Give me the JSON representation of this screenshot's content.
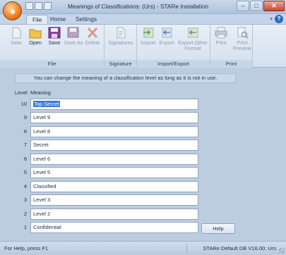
{
  "window": {
    "title": "Meanings of Classifications: (Urs) - STARe Installation",
    "minimize": "–",
    "maximize": "□",
    "close": "✕"
  },
  "tabs": [
    {
      "label": "File",
      "active": true
    },
    {
      "label": "Home",
      "active": false
    },
    {
      "label": "Settings",
      "active": false
    }
  ],
  "help_glyph": "?",
  "ribbon": {
    "groups": [
      {
        "label": "File",
        "buttons": [
          {
            "label": "New",
            "enabled": false,
            "icon": "new-icon"
          },
          {
            "label": "Open",
            "enabled": true,
            "icon": "folder-icon"
          },
          {
            "label": "Save",
            "enabled": true,
            "icon": "save-icon"
          },
          {
            "label": "Save As",
            "enabled": false,
            "icon": "save-as-icon"
          },
          {
            "label": "Delete",
            "enabled": false,
            "icon": "delete-icon"
          }
        ]
      },
      {
        "label": "Signature",
        "buttons": [
          {
            "label": "Signatures",
            "enabled": false,
            "icon": "signature-icon"
          }
        ]
      },
      {
        "label": "Import/Export",
        "buttons": [
          {
            "label": "Import",
            "enabled": false,
            "icon": "import-icon"
          },
          {
            "label": "Export",
            "enabled": false,
            "icon": "export-icon"
          },
          {
            "label": "Export Other Format",
            "enabled": false,
            "icon": "export-other-icon"
          }
        ]
      },
      {
        "label": "Print",
        "buttons": [
          {
            "label": "Print",
            "enabled": false,
            "icon": "printer-icon"
          },
          {
            "label": "Print Preview",
            "enabled": false,
            "icon": "print-preview-icon"
          }
        ]
      }
    ]
  },
  "info_message": "You can change the meaning of a classification level as long as it is not in use.",
  "columns": {
    "level": "Level",
    "meaning": "Meaning"
  },
  "levels": [
    {
      "level": "10",
      "meaning": "Top Secret",
      "selected": true
    },
    {
      "level": "9",
      "meaning": "Level 9"
    },
    {
      "level": "8",
      "meaning": "Level 8"
    },
    {
      "level": "7",
      "meaning": "Secret"
    },
    {
      "level": "6",
      "meaning": "Level 6"
    },
    {
      "level": "5",
      "meaning": "Level 5"
    },
    {
      "level": "4",
      "meaning": "Classified"
    },
    {
      "level": "3",
      "meaning": "Level 3"
    },
    {
      "level": "2",
      "meaning": "Level 2"
    },
    {
      "level": "1",
      "meaning": "Confidential"
    }
  ],
  "help_button_label": "Help",
  "status": {
    "left": "For Help, press F1",
    "right": "STARe Default DB V16.00: Urs"
  }
}
